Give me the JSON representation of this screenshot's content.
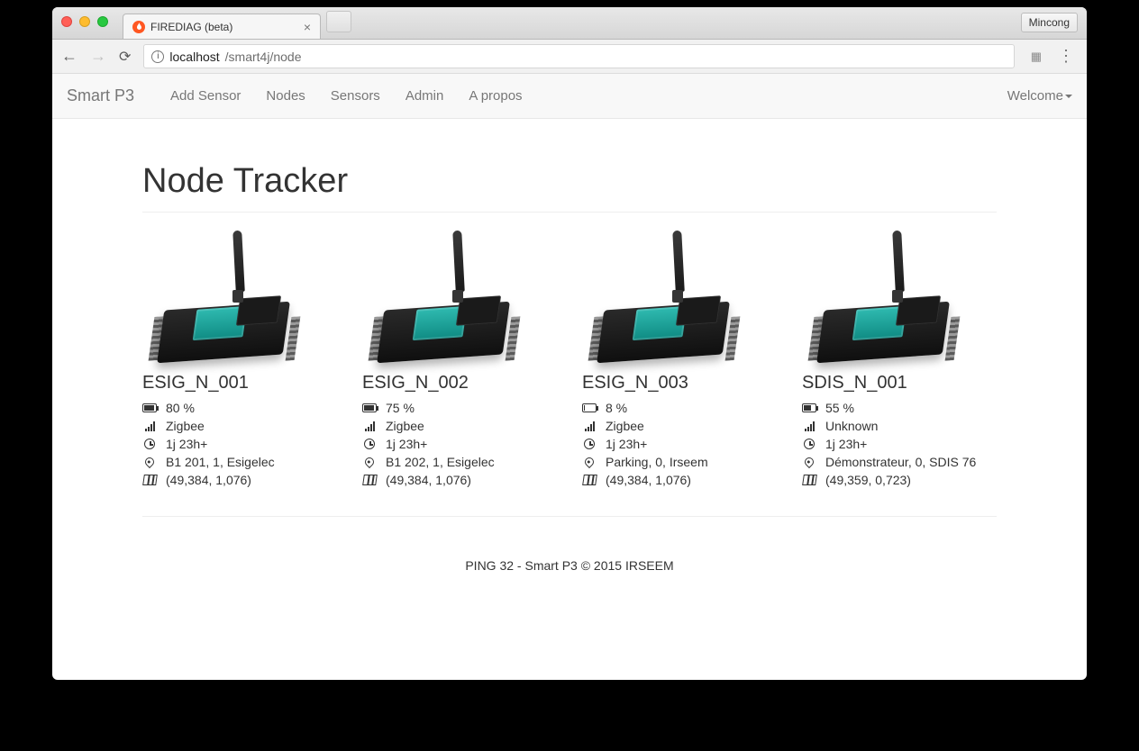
{
  "browser": {
    "tab_title": "FIREDIAG (beta)",
    "profile": "Mincong",
    "url_host": "localhost",
    "url_path": "/smart4j/node"
  },
  "navbar": {
    "brand": "Smart P3",
    "links": {
      "add_sensor": "Add Sensor",
      "nodes": "Nodes",
      "sensors": "Sensors",
      "admin": "Admin",
      "about": "A propos"
    },
    "welcome": "Welcome"
  },
  "page": {
    "title": "Node Tracker",
    "footer": "PING 32 - Smart P3 © 2015 IRSEEM"
  },
  "nodes": [
    {
      "name": "ESIG_N_001",
      "battery_text": "80 %",
      "battery_pct": 80,
      "network": "Zigbee",
      "uptime": "1j 23h+",
      "location": "B1 201, 1, Esigelec",
      "coords": "(49,384, 1,076)"
    },
    {
      "name": "ESIG_N_002",
      "battery_text": "75 %",
      "battery_pct": 75,
      "network": "Zigbee",
      "uptime": "1j 23h+",
      "location": "B1 202, 1, Esigelec",
      "coords": "(49,384, 1,076)"
    },
    {
      "name": "ESIG_N_003",
      "battery_text": "8 %",
      "battery_pct": 8,
      "network": "Zigbee",
      "uptime": "1j 23h+",
      "location": "Parking, 0, Irseem",
      "coords": "(49,384, 1,076)"
    },
    {
      "name": "SDIS_N_001",
      "battery_text": "55 %",
      "battery_pct": 55,
      "network": "Unknown",
      "uptime": "1j 23h+",
      "location": "Démonstrateur, 0, SDIS 76",
      "coords": "(49,359, 0,723)"
    }
  ]
}
